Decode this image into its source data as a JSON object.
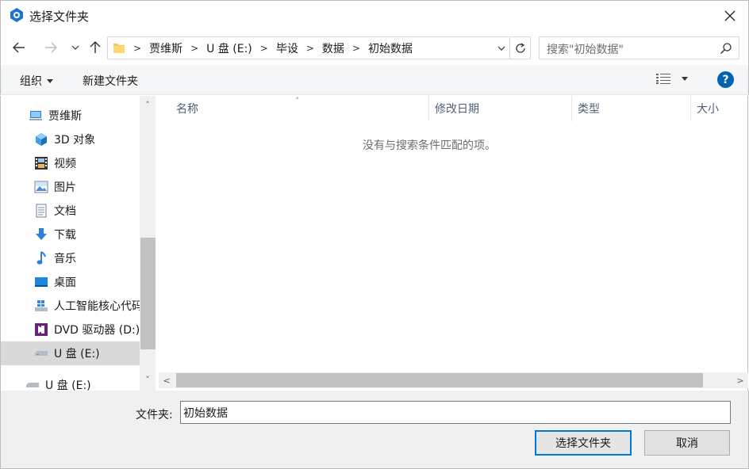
{
  "window": {
    "title": "选择文件夹"
  },
  "address": {
    "crumbs": [
      "贾维斯",
      "U 盘 (E:)",
      "毕设",
      "数据",
      "初始数据"
    ]
  },
  "search": {
    "placeholder": "搜索\"初始数据\""
  },
  "toolbar": {
    "organize_label": "组织",
    "new_folder_label": "新建文件夹"
  },
  "sidebar": {
    "items": [
      {
        "label": "贾维斯",
        "icon": "computer-icon"
      },
      {
        "label": "3D 对象",
        "icon": "3d-objects-icon"
      },
      {
        "label": "视频",
        "icon": "video-icon"
      },
      {
        "label": "图片",
        "icon": "pictures-icon"
      },
      {
        "label": "文档",
        "icon": "documents-icon"
      },
      {
        "label": "下载",
        "icon": "download-icon"
      },
      {
        "label": "音乐",
        "icon": "music-icon"
      },
      {
        "label": "桌面",
        "icon": "desktop-icon"
      },
      {
        "label": "人工智能核心代码",
        "icon": "windows-drive-icon"
      },
      {
        "label": "DVD 驱动器 (D:)",
        "icon": "dvd-drive-icon"
      },
      {
        "label": "U 盘 (E:)",
        "icon": "usb-drive-icon",
        "selected": true
      },
      {
        "label": "U 盘 (E:)",
        "icon": "usb-drive-icon"
      }
    ]
  },
  "filelist": {
    "columns": [
      "名称",
      "修改日期",
      "类型",
      "大小"
    ],
    "empty_message": "没有与搜索条件匹配的项。"
  },
  "footer": {
    "folder_label": "文件夹:",
    "folder_value": "初始数据",
    "select_button": "选择文件夹",
    "cancel_button": "取消"
  },
  "colors": {
    "accent": "#0078d7",
    "help": "#0063b1",
    "selected_row": "#d9d9d9"
  }
}
